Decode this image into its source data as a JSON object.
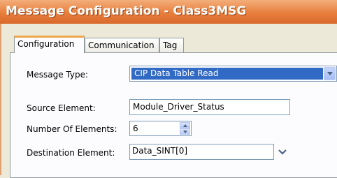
{
  "window": {
    "title": "Message Configuration - Class3MSG"
  },
  "tabs": [
    {
      "label": "Configuration",
      "active": true
    },
    {
      "label": "Communication",
      "active": false
    },
    {
      "label": "Tag",
      "active": false
    }
  ],
  "form": {
    "message_type": {
      "label": "Message Type:",
      "value": "CIP Data Table Read"
    },
    "source_element": {
      "label": "Source Element:",
      "value": "Module_Driver_Status"
    },
    "number_of_elements": {
      "label": "Number Of Elements:",
      "value": "6"
    },
    "destination_element": {
      "label": "Destination Element:",
      "value": "Data_SINT[0]"
    }
  },
  "colors": {
    "titlebar": "#e87e3c",
    "selection": "#316ac5",
    "active_tab_accent": "#f0a74c"
  },
  "icons": [
    "chevron-down-icon",
    "spin-up-icon",
    "spin-down-icon"
  ]
}
